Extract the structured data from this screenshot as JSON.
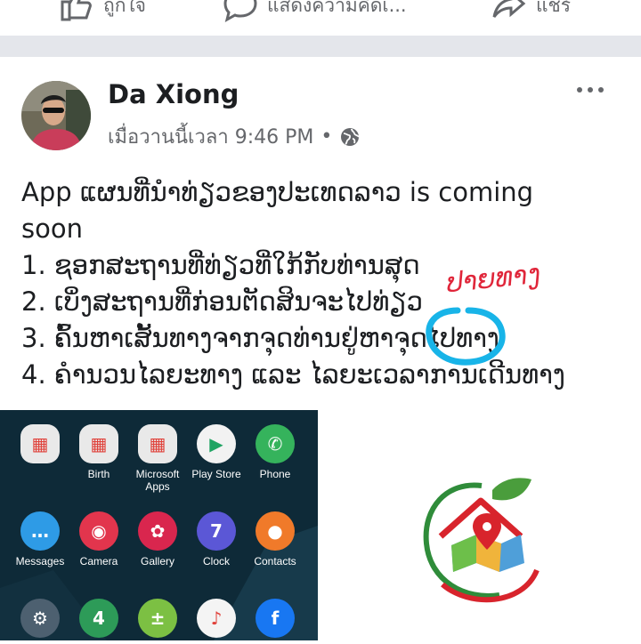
{
  "actions": {
    "like_label": "ถูกใจ",
    "comment_label": "แสดงความคิดเ...",
    "share_label": "แชร์"
  },
  "post": {
    "author": "Da Xiong",
    "time": "เมื่อวานนี้เวลา 9:46 PM",
    "separator": "•",
    "lines": [
      "App ແຜນທີ່ນຳທ່ຽວຂອງປະເທດລາວ  is coming",
      "soon",
      "1. ຊອກສະຖານທີ່ທ່ຽວທີ່ໃກ້ກັບທ່ານສຸດ",
      "2. ເບິ່ງສະຖານທີ່ກ່ອນຕັດສິນຈະໄປທ່ຽວ",
      "3. ຄົ້ນຫາເສັ້ນທາງຈາກຈຸດທ່ານຢູ່ຫາຈຸດໄປທາງ",
      "4. ຄຳນວນໄລຍະທາງ ແລະ ໄລຍະເວລາການເດີນທາງ"
    ],
    "annotation": "ປາຍທາງ"
  },
  "phone_apps": [
    {
      "label": "",
      "icon": "folder-icon",
      "color": "#e9e9e9"
    },
    {
      "label": "Birth",
      "icon": "folder-icon",
      "color": "#e9e9e9"
    },
    {
      "label": "Microsoft Apps",
      "icon": "folder-icon",
      "color": "#e9e9e9"
    },
    {
      "label": "Play Store",
      "icon": "play-store-icon",
      "color": "#f2f2f2"
    },
    {
      "label": "Phone",
      "icon": "phone-icon",
      "color": "#35b35c"
    },
    {
      "label": "Messages",
      "icon": "messages-icon",
      "color": "#2e9be6"
    },
    {
      "label": "Camera",
      "icon": "camera-icon",
      "color": "#e2354d"
    },
    {
      "label": "Gallery",
      "icon": "gallery-icon",
      "color": "#d9264e"
    },
    {
      "label": "Clock",
      "icon": "clock-icon",
      "color": "#5b57d6"
    },
    {
      "label": "Contacts",
      "icon": "contacts-icon",
      "color": "#f07a2a"
    },
    {
      "label": "",
      "icon": "settings-icon",
      "color": "#4d6070"
    },
    {
      "label": "",
      "icon": "calendar-icon",
      "color": "#2d9b58"
    },
    {
      "label": "",
      "icon": "calculator-icon",
      "color": "#7cc043"
    },
    {
      "label": "",
      "icon": "music-icon",
      "color": "#f4f4f4"
    },
    {
      "label": "",
      "icon": "facebook-icon",
      "color": "#1877f2"
    }
  ]
}
